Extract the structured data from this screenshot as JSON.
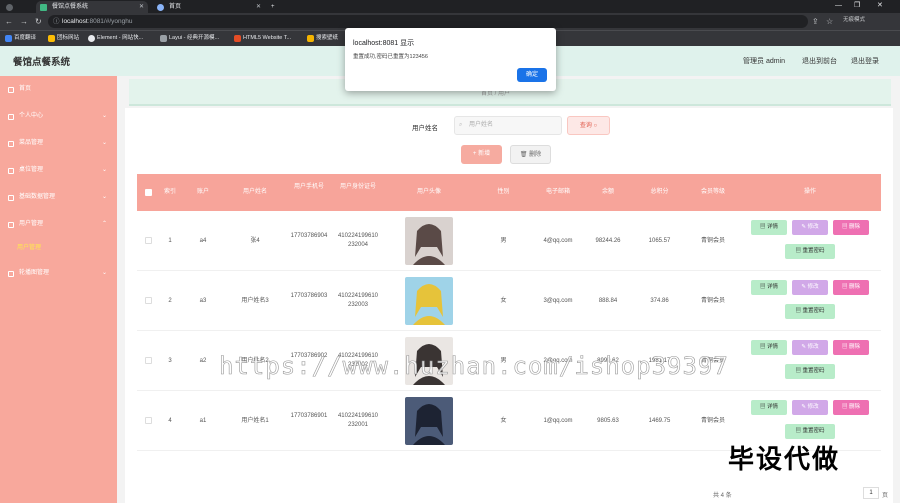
{
  "browser": {
    "tabs": [
      {
        "title": "餐馆点餐系统",
        "active": true
      },
      {
        "title": "首页",
        "active": false
      }
    ],
    "url_host": "localhost",
    "url_path": ":8081/#/yonghu",
    "bookmarks": [
      "百度翻译",
      "团标网站",
      "Element - 网站快...",
      "Layui - 经典开源模...",
      "HTML5 Website T...",
      "搜索壁纸"
    ],
    "guest_label": "无痕模式"
  },
  "header": {
    "title": "餐馆点餐系统",
    "user_label": "管理员 admin",
    "front_link": "退出到前台",
    "logout_link": "退出登录"
  },
  "sidebar": {
    "items": [
      {
        "label": "首页",
        "icon": "home-icon"
      },
      {
        "label": "个人中心",
        "icon": "user-icon"
      },
      {
        "label": "菜品管理",
        "icon": "dish-icon"
      },
      {
        "label": "桌位管理",
        "icon": "table-icon"
      },
      {
        "label": "基础数据管理",
        "icon": "data-icon"
      },
      {
        "label": "用户管理",
        "icon": "users-icon"
      },
      {
        "label": "轮播图管理",
        "icon": "image-icon"
      }
    ],
    "active_sub": "用户管理"
  },
  "breadcrumb": {
    "text": "首页  /  用户"
  },
  "search": {
    "label": "用户姓名",
    "placeholder": "用户姓名",
    "button": "查询"
  },
  "actions": {
    "add": "+ 新增",
    "delete": "删除"
  },
  "table": {
    "columns": [
      "索引",
      "账户",
      "用户姓名",
      "用户手机号",
      "用户身份证号",
      "用户头像",
      "性别",
      "电子邮箱",
      "余额",
      "总积分",
      "会员等级",
      "操作"
    ],
    "rows": [
      {
        "index": "1",
        "account": "a4",
        "name": "张4",
        "phone": "17703786904",
        "idcard": "410224199610232004",
        "gender": "男",
        "email": "4@qq.com",
        "balance": "98244.26",
        "points": "1065.57",
        "level": "青铜会员"
      },
      {
        "index": "2",
        "account": "a3",
        "name": "用户姓名3",
        "phone": "17703786903",
        "idcard": "410224199610232003",
        "gender": "女",
        "email": "3@qq.com",
        "balance": "888.84",
        "points": "374.86",
        "level": "青铜会员"
      },
      {
        "index": "3",
        "account": "a2",
        "name": "用户姓名2",
        "phone": "17703786902",
        "idcard": "410224199610232002",
        "gender": "男",
        "email": "2@qq.com",
        "balance": "8999.62",
        "points": "1981.17",
        "level": "青铜会员"
      },
      {
        "index": "4",
        "account": "a1",
        "name": "用户姓名1",
        "phone": "17703786901",
        "idcard": "410224199610232001",
        "gender": "女",
        "email": "1@qq.com",
        "balance": "9805.63",
        "points": "1469.75",
        "level": "青铜会员"
      }
    ],
    "row_buttons": {
      "detail": "详情",
      "edit": "修改",
      "delete": "删除",
      "reset": "重置密码"
    }
  },
  "pager": {
    "total": "共 4 条",
    "current": "1",
    "unit": "页"
  },
  "dialog": {
    "title": "localhost:8081 显示",
    "message": "重置成功,密码已重置为123456",
    "ok": "确定"
  },
  "watermark": "https://www.huzhan.com/ishop39397",
  "badge": "毕设代做"
}
